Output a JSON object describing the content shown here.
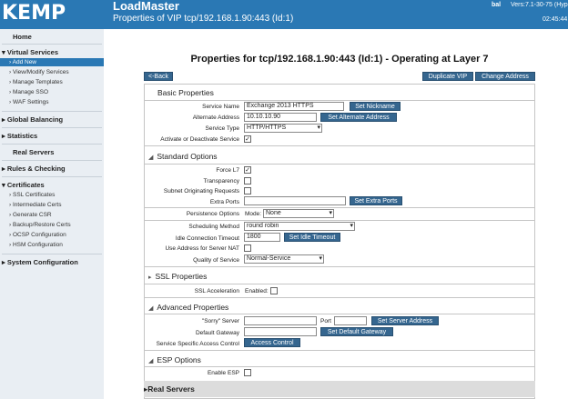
{
  "header": {
    "logo": "KEMP",
    "app_name": "LoadMaster",
    "subtitle": "Properties of VIP tcp/192.168.1.90:443 (Id:1)",
    "user": "bal",
    "version": "Vers:7.1-30-75 (Hype",
    "clock": "02:45:44"
  },
  "sidebar": {
    "home": "Home",
    "virtual_services": "Virtual Services",
    "vs_items": [
      "Add New",
      "View/Modify Services",
      "Manage Templates",
      "Manage SSO",
      "WAF Settings"
    ],
    "global_balancing": "Global Balancing",
    "statistics": "Statistics",
    "real_servers": "Real Servers",
    "rules_checking": "Rules & Checking",
    "certificates": "Certificates",
    "cert_items": [
      "SSL Certificates",
      "Intermediate Certs",
      "Generate CSR",
      "Backup/Restore Certs",
      "OCSP Configuration",
      "HSM Configuration"
    ],
    "system_configuration": "System Configuration"
  },
  "main": {
    "title": "Properties for tcp/192.168.1.90:443 (Id:1) - Operating at Layer 7",
    "back_button": "<-Back",
    "duplicate_button": "Duplicate VIP",
    "change_address_button": "Change Address"
  },
  "basic": {
    "header": "Basic Properties",
    "service_name_label": "Service Name",
    "service_name_value": "Exchange 2013 HTTPS",
    "set_nickname_button": "Set Nickname",
    "alternate_address_label": "Alternate Address",
    "alternate_address_value": "10.10.10.90",
    "set_alternate_button": "Set Alternate Address",
    "service_type_label": "Service Type",
    "service_type_value": "HTTP/HTTPS",
    "activate_label": "Activate or Deactivate Service",
    "check_mark": "✓"
  },
  "standard": {
    "header": "Standard Options",
    "force_l7_label": "Force L7",
    "transparency_label": "Transparency",
    "subnet_label": "Subnet Originating Requests",
    "extra_ports_label": "Extra Ports",
    "set_extra_ports_button": "Set Extra Ports",
    "persistence_label": "Persistence Options",
    "mode_label": "Mode:",
    "mode_value": "None",
    "scheduling_label": "Scheduling Method",
    "scheduling_value": "round robin",
    "idle_label": "Idle Connection Timeout",
    "idle_value": "1800",
    "set_idle_button": "Set Idle Timeout",
    "use_address_label": "Use Address for Server NAT",
    "qos_label": "Quality of Service",
    "qos_value": "Normal-Service"
  },
  "ssl": {
    "header": "SSL Properties",
    "acceleration_label": "SSL Acceleration",
    "enabled_label": "Enabled:"
  },
  "advanced": {
    "header": "Advanced Properties",
    "sorry_label": "\"Sorry\" Server",
    "port_label": "Port",
    "set_server_button": "Set Server Address",
    "gateway_label": "Default Gateway",
    "set_gateway_button": "Set Default Gateway",
    "access_label": "Service Specific Access Control",
    "access_button": "Access Control"
  },
  "esp": {
    "header": "ESP Options",
    "enable_label": "Enable ESP"
  },
  "real_servers": {
    "header": "Real Servers"
  }
}
